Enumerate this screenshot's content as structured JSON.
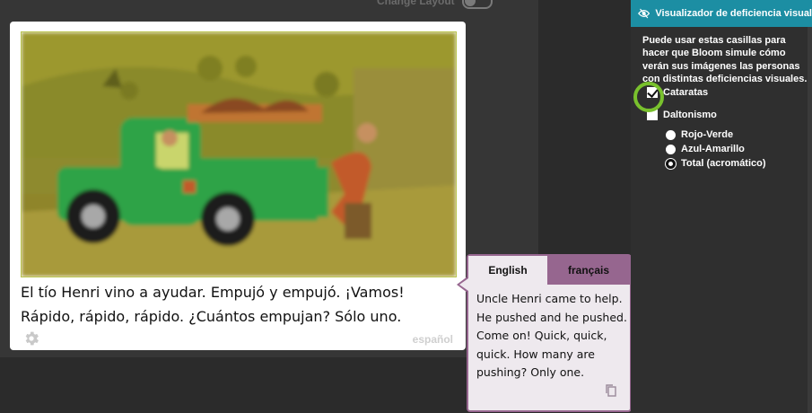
{
  "toolbar": {
    "change_layout_label": "Change Layout"
  },
  "page": {
    "text_lines": [
      "El tío Henri vino a ayudar. Empujó y empujó. ¡Vamos!",
      "Rápido, rápido, rápido. ¿Cuántos empujan? Sólo uno."
    ],
    "language_label": "español",
    "image_icon": "truck-illustration"
  },
  "translation_bubble": {
    "tabs": [
      {
        "label": "English",
        "active": true
      },
      {
        "label": "français",
        "active": false
      }
    ],
    "text_lines": [
      "Uncle Henri came to help.",
      "He pushed and he pushed.",
      "Come on! Quick, quick,",
      "quick. How many are",
      "pushing? Only one."
    ],
    "copy_icon": "copy-icon"
  },
  "side_panel": {
    "title": "Visualizador de deficiencia visual",
    "description_lines": [
      "Puede usar estas casillas para",
      "hacer que Bloom simule cómo",
      "verán sus imágenes las personas",
      "con distintas deficiencias visuales."
    ],
    "options": {
      "cataracts": {
        "label": "Cataratas",
        "checked": true
      },
      "colorblind": {
        "label": "Daltonismo",
        "checked": false
      }
    },
    "radios": [
      {
        "label": "Rojo-Verde",
        "selected": false
      },
      {
        "label": "Azul-Amarillo",
        "selected": false
      },
      {
        "label": "Total (acromático)",
        "selected": true
      }
    ]
  },
  "colors": {
    "accent_header": "#1c8ea3",
    "bubble_border": "#96668f",
    "highlight_ring": "#79c12d"
  }
}
